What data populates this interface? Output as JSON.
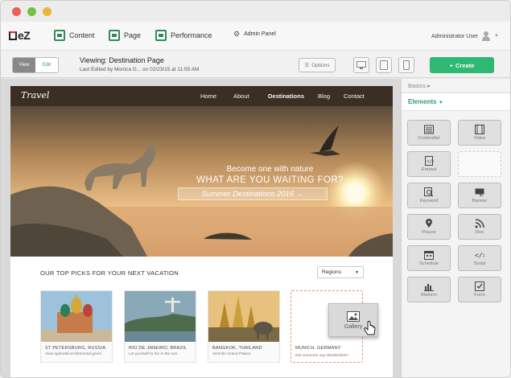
{
  "app": {
    "logo_text": "eZ"
  },
  "topnav": {
    "content_label": "Content",
    "page_label": "Page",
    "performance_label": "Performance",
    "admin_label": "Admin Panel",
    "user_label": "Administrator User"
  },
  "toolbar": {
    "view_label": "View",
    "edit_label": "Edit",
    "viewing_title": "Viewing: Destination Page",
    "last_edited": "Last Edited by Monica G... on 02/23/15 at 11:55 AM",
    "options_label": "Options",
    "create_label": "Create"
  },
  "site": {
    "logo": "Travel",
    "nav": [
      "Home",
      "About",
      "Destinations",
      "Blog",
      "Contact"
    ],
    "hero": {
      "line1": "Become one with nature",
      "line2": "WHAT ARE YOU WAITING FOR?",
      "line3": "Summer Destinations 2016 →"
    },
    "section_title": "OUR TOP PICKS FOR YOUR NEXT VACATION",
    "regions_label": "Regions",
    "cards": [
      {
        "title": "ST PETERSBURG, RUSSIA",
        "subtitle": "View splendid architectural gems"
      },
      {
        "title": "RIO DE JANEIRO, BRAZIL",
        "subtitle": "Let yourself to fun in the sun"
      },
      {
        "title": "BANGKOK, THAILAND",
        "subtitle": "Visit the Grand Palace"
      },
      {
        "title": "MUNICH, GERMANY",
        "subtitle": "Did someone say Oktoberfest?"
      }
    ],
    "drag_item_label": "Gallery"
  },
  "panel": {
    "basics_label": "Basics",
    "elements_label": "Elements",
    "tiles": [
      "Contentlist",
      "Video",
      "Embed",
      "",
      "Keyword",
      "Banner",
      "Places",
      "Rss",
      "Schedule",
      "Script",
      "Maform",
      "Form"
    ]
  },
  "colors": {
    "accent": "#2eb872",
    "nav_bg": "#3b2f24"
  }
}
